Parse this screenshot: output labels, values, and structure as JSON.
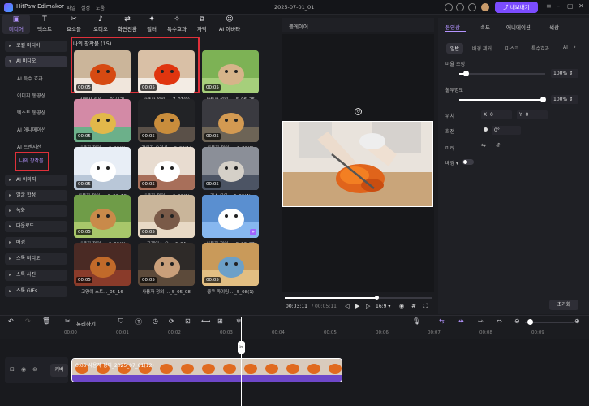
{
  "app": {
    "name": "HitPaw Edimakor",
    "menus": [
      "파일",
      "설정",
      "도움"
    ],
    "document": "2025-07-01_01",
    "export_label": "내보내기"
  },
  "toolbar": [
    {
      "label": "미디어",
      "icon": "media-icon"
    },
    {
      "label": "텍스트",
      "icon": "text-icon"
    },
    {
      "label": "요소들",
      "icon": "elements-icon"
    },
    {
      "label": "오디오",
      "icon": "audio-icon"
    },
    {
      "label": "화면전환",
      "icon": "transition-icon"
    },
    {
      "label": "필터",
      "icon": "filter-icon"
    },
    {
      "label": "특수효과",
      "icon": "effects-icon"
    },
    {
      "label": "자막",
      "icon": "subtitle-icon"
    },
    {
      "label": "AI 아바타",
      "icon": "avatar-icon"
    }
  ],
  "sidebar": {
    "items": [
      {
        "label": "로컬 미디어"
      },
      {
        "label": "AI 비디오"
      },
      {
        "label": "AI 이미지"
      },
      {
        "label": "얼굴 합성"
      },
      {
        "label": "녹화"
      },
      {
        "label": "다운로드"
      },
      {
        "label": "배경"
      },
      {
        "label": "스톡 비디오"
      },
      {
        "label": "스톡 사진"
      },
      {
        "label": "스톡 GIFs"
      }
    ],
    "subitems": [
      {
        "label": "AI 특수 효과"
      },
      {
        "label": "이미지 동영상 ..."
      },
      {
        "label": "텍스트 동영상 ..."
      },
      {
        "label": "AI 애니메이션"
      },
      {
        "label": "AI 트렌지션"
      },
      {
        "label": "나의 창작물"
      }
    ]
  },
  "grid": {
    "title": "나의 창작물 (15)",
    "items": [
      {
        "caption": "사용자 정의 ..._01(12)",
        "duration": "00:05",
        "scene": "tomato"
      },
      {
        "caption": "사용자 정의 ..._7_01(9)",
        "duration": "00:05",
        "scene": "tomato2"
      },
      {
        "caption": "사용자 정의 ..._5_06_26",
        "duration": "00:05",
        "scene": "cat-grass"
      },
      {
        "caption": "사용자 정의 ..._6_23(7)",
        "duration": "00:05",
        "scene": "colorful"
      },
      {
        "caption": "강아지 요리사..._6_23(1)",
        "duration": "00:05",
        "scene": "bear"
      },
      {
        "caption": "사용자 정의 ..._6_23(6)",
        "duration": "00:05",
        "scene": "bear2"
      },
      {
        "caption": "사용자 정의 ..._5_06_18",
        "duration": "00:05",
        "scene": "white-cat"
      },
      {
        "caption": "사용자 정의 ..._6_06(5)",
        "duration": "00:05",
        "scene": "white-bear"
      },
      {
        "caption": "키스 유아 ...6_06(4)",
        "duration": "00:05",
        "scene": "group"
      },
      {
        "caption": "사용자 정의 ..._6_06(3)",
        "duration": "00:05",
        "scene": "dog-grass"
      },
      {
        "caption": "그레이스 오..._6_04",
        "duration": "00:05",
        "scene": "couple"
      },
      {
        "caption": "사용자 정의 ..._5_06_03",
        "duration": "",
        "scene": "white-cat2",
        "badge": "AI"
      },
      {
        "caption": "고양이 스토..._05_16",
        "duration": "00:05",
        "scene": "cat-cafe"
      },
      {
        "caption": "사용자 정의 ..._5_05_08",
        "duration": "00:05",
        "scene": "girl"
      },
      {
        "caption": "콩쿠 파이팅 ..._5_08(1)",
        "duration": "00:05",
        "scene": "desert"
      }
    ]
  },
  "player": {
    "label": "플레이어",
    "time_current": "00:03:11",
    "time_total": "00:05:11",
    "progress": 0.62,
    "ratio": "16:9"
  },
  "props": {
    "tabs": [
      "동영상",
      "속도",
      "애니메이션",
      "색상"
    ],
    "subtabs": [
      "일반",
      "배경 제거",
      "마스크",
      "특수효과",
      "AI"
    ],
    "scale_label": "비율 조정",
    "scale_value": "100%",
    "opacity_label": "불투명도",
    "opacity_value": "100%",
    "position_label": "위치",
    "pos_x_label": "X",
    "pos_x": "0",
    "pos_y_label": "Y",
    "pos_y": "0",
    "rotate_label": "회전",
    "rotate_value": "0°",
    "mirror_label": "미러",
    "bg_label": "배경",
    "reset_label": "초기화"
  },
  "timeline": {
    "split_label": "분리하기",
    "ticks": [
      "00:00",
      "00:01",
      "00:02",
      "00:03",
      "00:04",
      "00:05",
      "00:06",
      "00:07",
      "00:08",
      "00:09"
    ],
    "cover_label": "커버",
    "clip_label": "0:05  사용자 정의_2025_07_01(12)"
  }
}
